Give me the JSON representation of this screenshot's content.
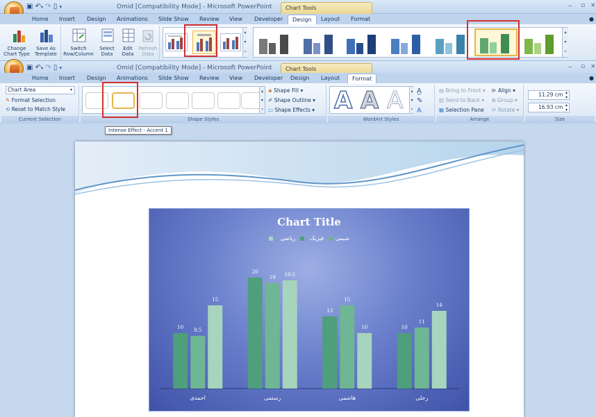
{
  "window_a": {
    "title": "Omid [Compatibility Mode] - Microsoft PowerPoint",
    "context_label": "Chart Tools",
    "qat_icons": [
      "save-icon",
      "undo-icon",
      "redo-icon",
      "new-icon"
    ],
    "tabs": [
      "Home",
      "Insert",
      "Design",
      "Animations",
      "Slide Show",
      "Review",
      "View",
      "Developer",
      "Design",
      "Layout",
      "Format"
    ],
    "selected_tab": "Design",
    "type_group": {
      "change_chart_type": "Change\nChart Type",
      "save_as_template": "Save As\nTemplate"
    },
    "data_group": {
      "switch": "Switch\nRow/Column",
      "select": "Select\nData",
      "edit": "Edit\nData",
      "refresh": "Refresh\nData"
    }
  },
  "window_b": {
    "title": "Omid [Compatibility Mode] - Microsoft PowerPoint",
    "context_label": "Chart Tools",
    "tabs": [
      "Home",
      "Insert",
      "Design",
      "Animations",
      "Slide Show",
      "Review",
      "View",
      "Developer",
      "Design",
      "Layout",
      "Format"
    ],
    "selected_tab": "Format",
    "current_selection": {
      "dropdown_value": "Chart Area",
      "format_selection": "Format Selection",
      "reset_style": "Reset to Match Style",
      "group_name": "Current Selection"
    },
    "shape_styles": {
      "button_label": "Abc",
      "colors": [
        "#3b3b3b",
        "#4f6fb8",
        "#5b8fd6",
        "#6fb3d9",
        "#6cc089",
        "#66b46c",
        "#86c24f"
      ],
      "shape_fill": "Shape Fill",
      "shape_outline": "Shape Outline",
      "shape_effects": "Shape Effects",
      "group_name": "Shape Styles"
    },
    "wordart": {
      "letter": "A",
      "group_name": "WordArt Styles"
    },
    "arrange": {
      "bring_to_front": "Bring to Front",
      "send_to_back": "Send to Back",
      "selection_pane": "Selection Pane",
      "align": "Align",
      "group": "Group",
      "rotate": "Rotate",
      "group_name": "Arrange"
    },
    "size": {
      "height": "11.29 cm",
      "width": "16.93 cm",
      "group_name": "Size"
    }
  },
  "tooltip": "Intense Effect - Accent 1",
  "chart_data": {
    "type": "bar",
    "title": "Chart Title",
    "categories": [
      "احمدی",
      "رستمی",
      "هاشمی",
      "رحلی"
    ],
    "series": [
      {
        "name": "ریاضی",
        "color": "#4f9e7c",
        "values": [
          10,
          20,
          13,
          10
        ]
      },
      {
        "name": "فیزیک",
        "color": "#6fb694",
        "values": [
          9.5,
          19,
          15,
          11
        ]
      },
      {
        "name": "شیمی",
        "color": "#a7d4bc",
        "values": [
          15,
          19.5,
          10,
          14
        ]
      }
    ],
    "ylim": [
      0,
      20
    ],
    "legend": "top",
    "grid": false
  }
}
